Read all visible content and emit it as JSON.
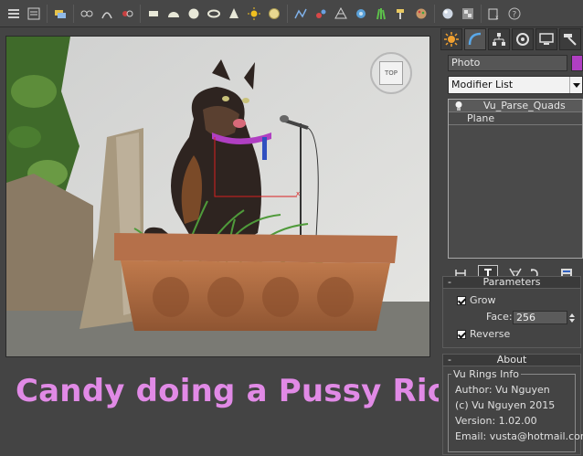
{
  "toolbar": {
    "icons": [
      "select-object-icon",
      "select-by-name-icon",
      "layer-icon",
      "bind-spacewarp-icon",
      "link-icon",
      "unlink-icon",
      "plane-icon",
      "hemisphere-icon",
      "sphere-icon",
      "torus-icon",
      "cone-icon",
      "sun-icon",
      "geosphere-icon",
      "spline-icon",
      "molecule-icon",
      "lattice-icon",
      "teapot-icon",
      "grass-icon",
      "hammer-tool-icon",
      "paint-icon",
      "material-ball-icon",
      "render-icon",
      "script-icon",
      "help-icon"
    ]
  },
  "viewport": {
    "viewcube_label": "TOP",
    "caption": "Candy doing a Pussy Riot"
  },
  "panel": {
    "tabs": [
      "create-tab",
      "modify-tab",
      "hierarchy-tab",
      "motion-tab",
      "display-tab",
      "utilities-tab"
    ],
    "object_name": "Photo",
    "object_color": "#b03fc2",
    "modifier_list": "Modifier List",
    "stack": [
      {
        "label": "Vu_Parse_Quads",
        "type": "modifier"
      },
      {
        "label": "Plane",
        "type": "base"
      }
    ],
    "parameters": {
      "title": "Parameters",
      "collapse": "-",
      "grow_label": "Grow",
      "grow_checked": true,
      "face_label": "Face:",
      "face_value": "256",
      "reverse_label": "Reverse",
      "reverse_checked": true
    },
    "about": {
      "title": "About",
      "collapse": "-",
      "group_label": "Vu Rings Info",
      "lines": [
        "Author: Vu Nguyen",
        "(c) Vu Nguyen 2015",
        "Version: 1.02.00",
        "Email: vusta@hotmail.com"
      ]
    }
  }
}
